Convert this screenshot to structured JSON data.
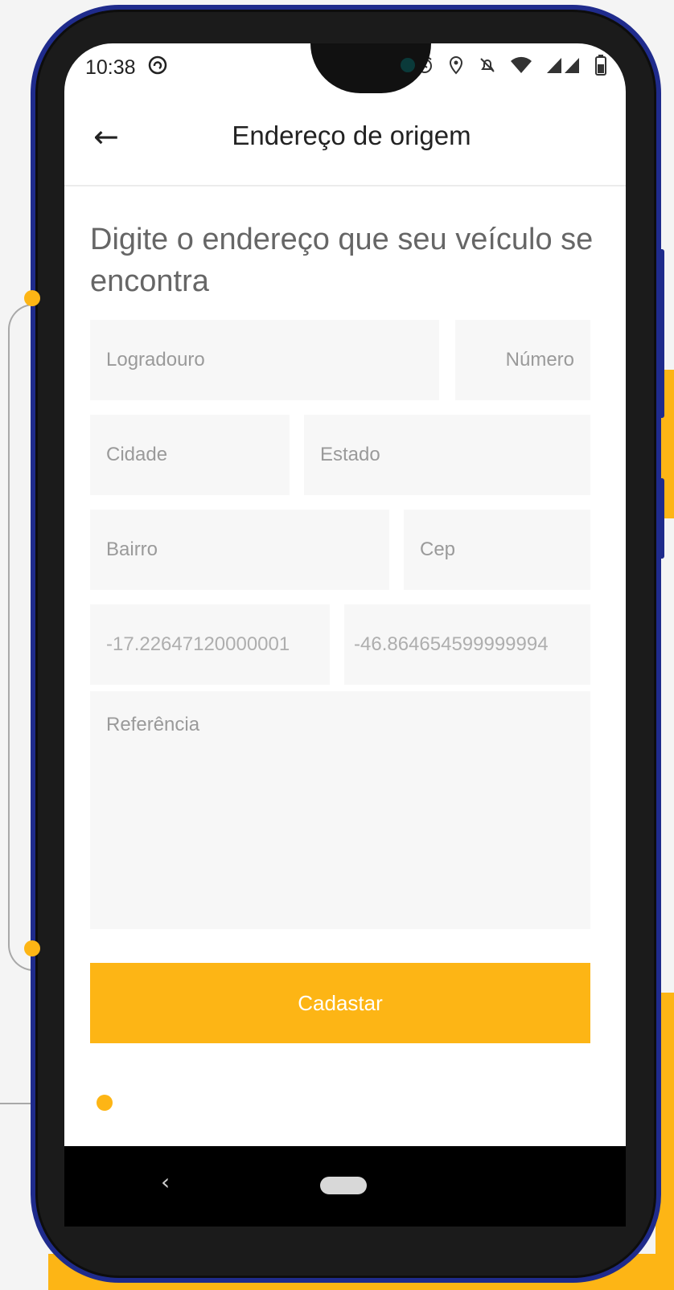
{
  "status_bar": {
    "time": "10:38",
    "left_icon": "sync-circle-icon",
    "right_icons": [
      "alarm-icon",
      "location-icon",
      "notifications-off-icon",
      "wifi-icon",
      "signal-icon",
      "battery-icon"
    ]
  },
  "app_bar": {
    "title": "Endereço de origem",
    "back_icon": "arrow-left-icon"
  },
  "form": {
    "title": "Digite o endereço que seu veículo se encontra",
    "logradouro_placeholder": "Logradouro",
    "numero_placeholder": "Número",
    "cidade_placeholder": "Cidade",
    "estado_placeholder": "Estado",
    "bairro_placeholder": "Bairro",
    "cep_placeholder": "Cep",
    "latitude_value": "-17.22647120000001",
    "longitude_value": "-46.864654599999994",
    "referencia_placeholder": "Referência",
    "submit_label": "Cadastar"
  },
  "colors": {
    "accent": "#FDB515",
    "phone_frame": "#1f2b8c",
    "field_bg": "#f7f7f7",
    "text_dark": "#222222",
    "text_muted": "#9a9a9a"
  }
}
